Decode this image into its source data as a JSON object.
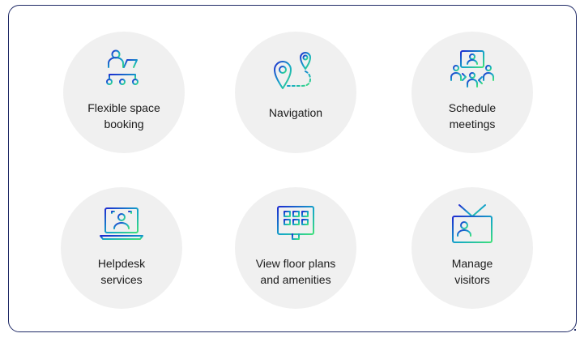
{
  "features": [
    {
      "label": "Flexible space\nbooking",
      "icon": "desk-booking-icon"
    },
    {
      "label": "Navigation",
      "icon": "navigation-pins-icon"
    },
    {
      "label": "Schedule\nmeetings",
      "icon": "meeting-icon"
    },
    {
      "label": "Helpdesk\nservices",
      "icon": "helpdesk-laptop-icon"
    },
    {
      "label": "View floor plans\nand amenities",
      "icon": "floor-plan-monitor-icon"
    },
    {
      "label": "Manage\nvisitors",
      "icon": "visitor-badge-icon"
    }
  ],
  "colors": {
    "gradient_start": "#1e2bd0",
    "gradient_mid": "#14a8c8",
    "gradient_end": "#3ee07a",
    "card_background": "#f0f0f0",
    "frame_border": "#1f2a66"
  }
}
